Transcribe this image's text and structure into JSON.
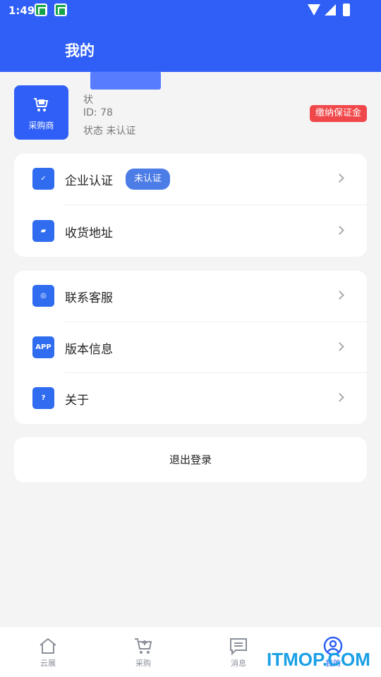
{
  "status_bar": {
    "time": "1:49"
  },
  "header": {
    "title": "我的"
  },
  "profile": {
    "role_label": "采购商",
    "line1": "状",
    "id_line": "ID: 78",
    "status_line": "状态 未认证",
    "deposit_label": "缴纳保证金"
  },
  "menu_group_1": {
    "items": [
      {
        "label": "企业认证",
        "tag": "未认证"
      },
      {
        "label": "收货地址"
      }
    ]
  },
  "menu_group_2": {
    "items": [
      {
        "label": "联系客服"
      },
      {
        "label": "版本信息",
        "icon_text": "APP"
      },
      {
        "label": "关于"
      }
    ]
  },
  "logout_label": "退出登录",
  "tabbar": {
    "tabs": [
      {
        "label": "云展"
      },
      {
        "label": "采购"
      },
      {
        "label": "消息"
      },
      {
        "label": "我的"
      }
    ]
  },
  "watermark": "ITMOP.COM",
  "colors": {
    "primary": "#2f5ff6",
    "danger": "#f0484a",
    "tag": "#4c7ce6"
  }
}
